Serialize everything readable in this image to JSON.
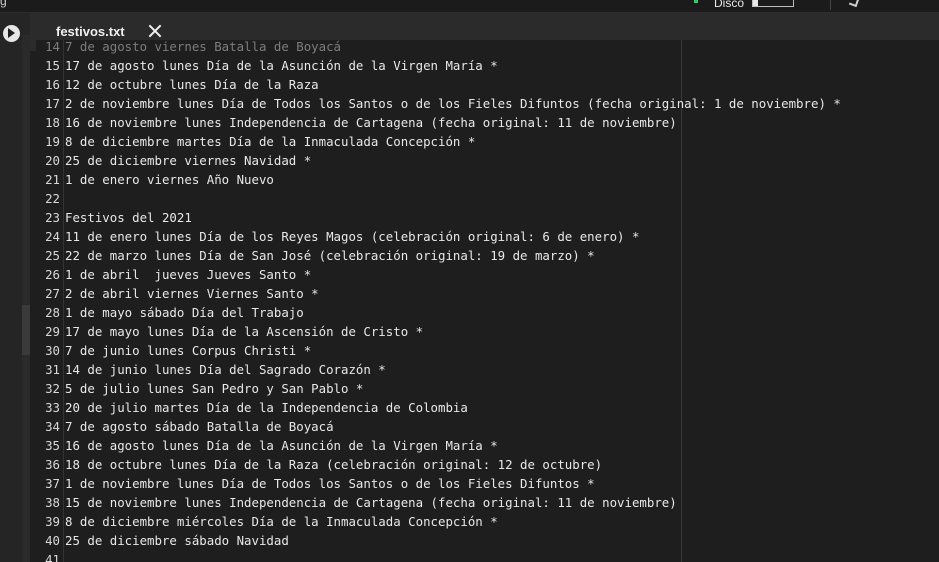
{
  "topbar": {
    "left_fragment": "g",
    "disk_label": "Disco",
    "disk_usage_fraction": 0.12
  },
  "sidebar": {
    "run_icon": "play-circle-icon"
  },
  "tab": {
    "title": "festivos.txt",
    "close_icon": "close-icon"
  },
  "editor": {
    "lines": [
      {
        "n": "14",
        "text": "7 de agosto viernes Batalla de Boyacá",
        "faded": true
      },
      {
        "n": "15",
        "text": "17 de agosto lunes Día de la Asunción de la Virgen María *"
      },
      {
        "n": "16",
        "text": "12 de octubre lunes Día de la Raza"
      },
      {
        "n": "17",
        "text": "2 de noviembre lunes Día de Todos los Santos o de los Fieles Difuntos (fecha original: 1 de noviembre) *"
      },
      {
        "n": "18",
        "text": "16 de noviembre lunes Independencia de Cartagena (fecha original: 11 de noviembre)"
      },
      {
        "n": "19",
        "text": "8 de diciembre martes Día de la Inmaculada Concepción *"
      },
      {
        "n": "20",
        "text": "25 de diciembre viernes Navidad *"
      },
      {
        "n": "21",
        "text": "1 de enero viernes Año Nuevo"
      },
      {
        "n": "22",
        "text": ""
      },
      {
        "n": "23",
        "text": "Festivos del 2021"
      },
      {
        "n": "24",
        "text": "11 de enero lunes Día de los Reyes Magos (celebración original: 6 de enero) *"
      },
      {
        "n": "25",
        "text": "22 de marzo lunes Día de San José (celebración original: 19 de marzo) *"
      },
      {
        "n": "26",
        "text": "1 de abril  jueves Jueves Santo *"
      },
      {
        "n": "27",
        "text": "2 de abril viernes Viernes Santo *"
      },
      {
        "n": "28",
        "text": "1 de mayo sábado Día del Trabajo"
      },
      {
        "n": "29",
        "text": "17 de mayo lunes Día de la Ascensión de Cristo *"
      },
      {
        "n": "30",
        "text": "7 de junio lunes Corpus Christi *"
      },
      {
        "n": "31",
        "text": "14 de junio lunes Día del Sagrado Corazón *"
      },
      {
        "n": "32",
        "text": "5 de julio lunes San Pedro y San Pablo *"
      },
      {
        "n": "33",
        "text": "20 de julio martes Día de la Independencia de Colombia"
      },
      {
        "n": "34",
        "text": "7 de agosto sábado Batalla de Boyacá"
      },
      {
        "n": "35",
        "text": "16 de agosto lunes Día de la Asunción de la Virgen María *"
      },
      {
        "n": "36",
        "text": "18 de octubre lunes Día de la Raza (celebración original: 12 de octubre)"
      },
      {
        "n": "37",
        "text": "1 de noviembre lunes Día de Todos los Santos o de los Fieles Difuntos *"
      },
      {
        "n": "38",
        "text": "15 de noviembre lunes Independencia de Cartagena (fecha original: 11 de noviembre)"
      },
      {
        "n": "39",
        "text": "8 de diciembre miércoles Día de la Inmaculada Concepción *"
      },
      {
        "n": "40",
        "text": "25 de diciembre sábado Navidad"
      },
      {
        "n": "41",
        "text": ""
      }
    ]
  }
}
